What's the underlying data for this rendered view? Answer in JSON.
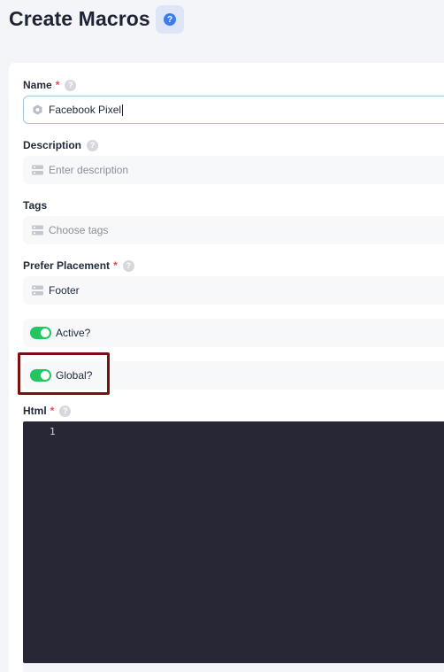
{
  "header": {
    "title": "Create Macros",
    "help_icon": "question-icon",
    "help_glyph": "?"
  },
  "form": {
    "name": {
      "label": "Name",
      "required": "*",
      "value": "Facebook Pixel"
    },
    "description": {
      "label": "Description",
      "placeholder": "Enter description"
    },
    "tags": {
      "label": "Tags",
      "placeholder": "Choose tags"
    },
    "placement": {
      "label": "Prefer Placement",
      "required": "*",
      "value": "Footer"
    },
    "active": {
      "label": "Active?",
      "enabled": true
    },
    "global": {
      "label": "Global?",
      "enabled": true
    },
    "html": {
      "label": "Html",
      "required": "*",
      "line_number": "1"
    }
  },
  "colors": {
    "accent": "#3d7cf0",
    "toggle_on": "#22c55e",
    "required": "#e5484d",
    "editor_bg": "#272735",
    "highlight_border": "#7b1010"
  }
}
